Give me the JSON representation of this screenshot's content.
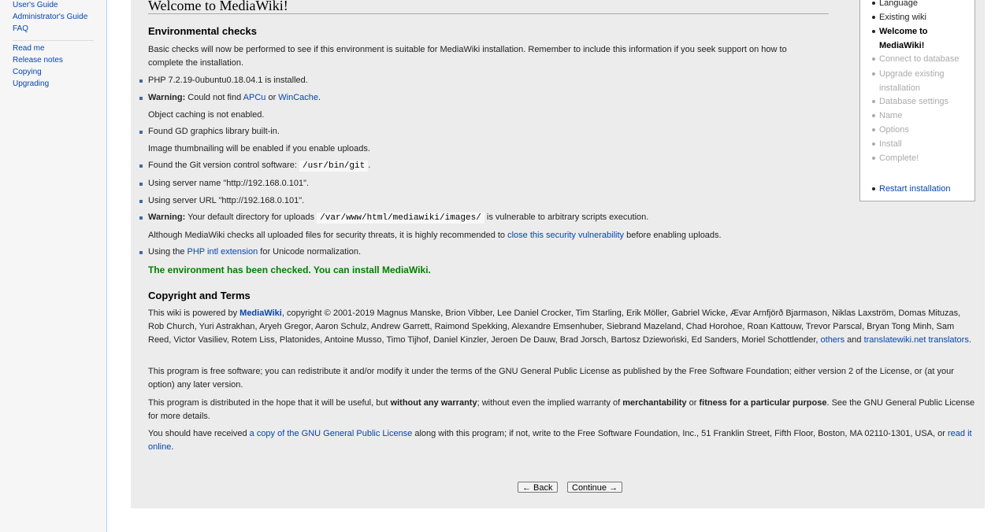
{
  "sidebar": {
    "group1": [
      "User's Guide",
      "Administrator's Guide",
      "FAQ"
    ],
    "group2": [
      "Read me",
      "Release notes",
      "Copying",
      "Upgrading"
    ]
  },
  "page_title": "Welcome to MediaWiki!",
  "env": {
    "heading": "Environmental checks",
    "intro": "Basic checks will now be performed to see if this environment is suitable for MediaWiki installation. Remember to include this information if you seek support on how to complete the installation.",
    "php_installed": "PHP 7.2.19-0ubuntu0.18.04.1 is installed.",
    "warning_label": "Warning:",
    "cache_text_1": " Could not find ",
    "apcu_link": "APCu",
    "or_text": " or ",
    "wincache_link": "WinCache",
    "period": ".",
    "cache_note": "Object caching is not enabled.",
    "gd_found": "Found GD graphics library built-in.",
    "gd_note": "Image thumbnailing will be enabled if you enable uploads.",
    "git_text": "Found the Git version control software: ",
    "git_path": "/usr/bin/git",
    "server_name": "Using server name \"http://192.168.0.101\".",
    "server_url": "Using server URL \"http://192.168.0.101\".",
    "upload_text_1": " Your default directory for uploads ",
    "upload_path": "/var/www/html/mediawiki/images/",
    "upload_text_2": " is vulnerable to arbitrary scripts execution.",
    "security_note_1": "Although MediaWiki checks all uploaded files for security threats, it is highly recommended to ",
    "security_link": "close this security vulnerability",
    "security_note_2": " before enabling uploads.",
    "intl_text_1": "Using the ",
    "intl_link": "PHP intl extension",
    "intl_text_2": " for Unicode normalization.",
    "success": "The environment has been checked. You can install MediaWiki."
  },
  "copyright": {
    "heading": "Copyright and Terms",
    "p1_start": "This wiki is powered by ",
    "mediawiki_link": "MediaWiki",
    "p1_authors": ", copyright © 2001-2019 Magnus Manske, Brion Vibber, Lee Daniel Crocker, Tim Starling, Erik Möller, Gabriel Wicke, Ævar Arnfjörð Bjarmason, Niklas Laxström, Domas Mituzas, Rob Church, Yuri Astrakhan, Aryeh Gregor, Aaron Schulz, Andrew Garrett, Raimond Spekking, Alexandre Emsenhuber, Siebrand Mazeland, Chad Horohoe, Roan Kattouw, Trevor Parscal, Bryan Tong Minh, Sam Reed, Victor Vasiliev, Rotem Liss, Platonides, Antoine Musso, Timo Tijhof, Daniel Kinzler, Jeroen De Dauw, Brad Jorsch, Bartosz Dziewoński, Ed Sanders, Moriel Schottlender, ",
    "others_link": "others",
    "and_text": " and ",
    "translators_link": "translatewiki.net translators",
    "end_period": ".",
    "p2": "This program is free software; you can redistribute it and/or modify it under the terms of the GNU General Public License as published by the Free Software Foundation; either version 2 of the License, or (at your option) any later version.",
    "p3_a": "This program is distributed in the hope that it will be useful, but ",
    "p3_b": "without any warranty",
    "p3_c": "; without even the implied warranty of ",
    "p3_d": "merchantability",
    "p3_e": " or ",
    "p3_f": "fitness for a particular purpose",
    "p3_g": ". See the GNU General Public License for more details.",
    "p4_a": "You should have received ",
    "p4_link1": "a copy of the GNU General Public License",
    "p4_b": " along with this program; if not, write to the Free Software Foundation, Inc., 51 Franklin Street, Fifth Floor, Boston, MA 02110-1301, USA, or ",
    "p4_link2": "read it online",
    "p4_c": "."
  },
  "steps": {
    "items": [
      "Language",
      "Existing wiki",
      "Welcome to MediaWiki!",
      "Connect to database",
      "Upgrade existing installation",
      "Database settings",
      "Name",
      "Options",
      "Install",
      "Complete!"
    ],
    "restart": "Restart installation"
  },
  "buttons": {
    "back": "← Back",
    "continue": "Continue →"
  }
}
